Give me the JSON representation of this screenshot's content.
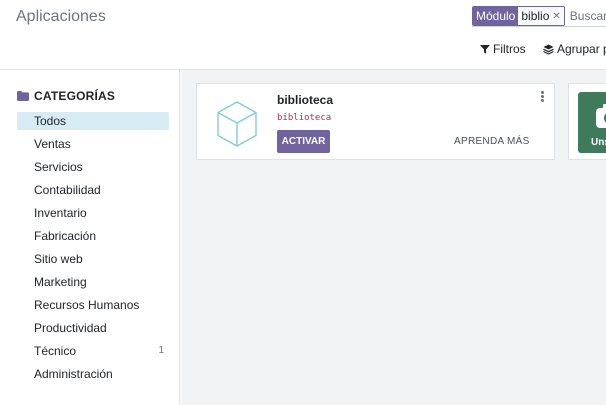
{
  "window": {
    "title": "Aplicaciones"
  },
  "search": {
    "facet_label": "Módulo",
    "facet_value": "biblio",
    "placeholder": "Buscar..."
  },
  "toolbar": {
    "filters_label": "Filtros",
    "group_label": "Agrupar por"
  },
  "sidebar": {
    "header": "CATEGORÍAS",
    "items": [
      {
        "label": "Todos",
        "active": true,
        "count": ""
      },
      {
        "label": "Ventas",
        "active": false,
        "count": ""
      },
      {
        "label": "Servicios",
        "active": false,
        "count": ""
      },
      {
        "label": "Contabilidad",
        "active": false,
        "count": ""
      },
      {
        "label": "Inventario",
        "active": false,
        "count": ""
      },
      {
        "label": "Fabricación",
        "active": false,
        "count": ""
      },
      {
        "label": "Sitio web",
        "active": false,
        "count": ""
      },
      {
        "label": "Marketing",
        "active": false,
        "count": ""
      },
      {
        "label": "Recursos Humanos",
        "active": false,
        "count": ""
      },
      {
        "label": "Productividad",
        "active": false,
        "count": ""
      },
      {
        "label": "Técnico",
        "active": false,
        "count": "1"
      },
      {
        "label": "Administración",
        "active": false,
        "count": ""
      }
    ]
  },
  "modules": [
    {
      "name": "biblioteca",
      "technical_name": "biblioteca",
      "activate_label": "ACTIVAR",
      "learn_more_label": "APRENDA MÁS",
      "icon": "cube-icon"
    }
  ],
  "partial_card": {
    "text": "Uns",
    "icon": "camera-icon"
  },
  "colors": {
    "primary": "#71639e",
    "active_category_bg": "#d7ebf5",
    "main_bg": "#f1f3f4",
    "technical_name": "#c7254e",
    "partial_tile": "#3f7a5b"
  }
}
